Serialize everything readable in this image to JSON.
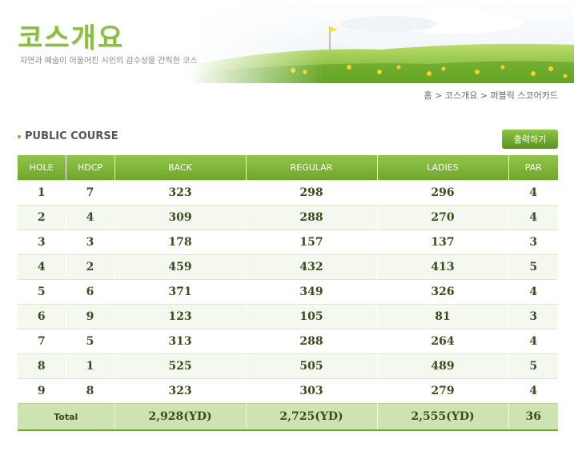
{
  "header": {
    "title": "코스개요",
    "subtitle": "자연과 예술이 어울어진 시인의 감수성을 간직한 코스"
  },
  "breadcrumb": "홈 > 코스개요 > 퍼블릭 스코어카드",
  "section": {
    "title": "PUBLIC COURSE",
    "print_label": "출력하기"
  },
  "table": {
    "columns": [
      "HOLE",
      "HDCP",
      "BACK",
      "REGULAR",
      "LADIES",
      "PAR"
    ],
    "rows": [
      [
        "1",
        "7",
        "323",
        "298",
        "296",
        "4"
      ],
      [
        "2",
        "4",
        "309",
        "288",
        "270",
        "4"
      ],
      [
        "3",
        "3",
        "178",
        "157",
        "137",
        "3"
      ],
      [
        "4",
        "2",
        "459",
        "432",
        "413",
        "5"
      ],
      [
        "5",
        "6",
        "371",
        "349",
        "326",
        "4"
      ],
      [
        "6",
        "9",
        "123",
        "105",
        "81",
        "3"
      ],
      [
        "7",
        "5",
        "313",
        "288",
        "264",
        "4"
      ],
      [
        "8",
        "1",
        "525",
        "505",
        "489",
        "5"
      ],
      [
        "9",
        "8",
        "323",
        "303",
        "279",
        "4"
      ]
    ],
    "total": {
      "label": "Total",
      "back": "2,928(YD)",
      "regular": "2,725(YD)",
      "ladies": "2,555(YD)",
      "par": "36"
    }
  },
  "colors": {
    "accent": "#7cb342",
    "header_bg": "#80b53a",
    "total_bg": "#cfe3b2"
  }
}
